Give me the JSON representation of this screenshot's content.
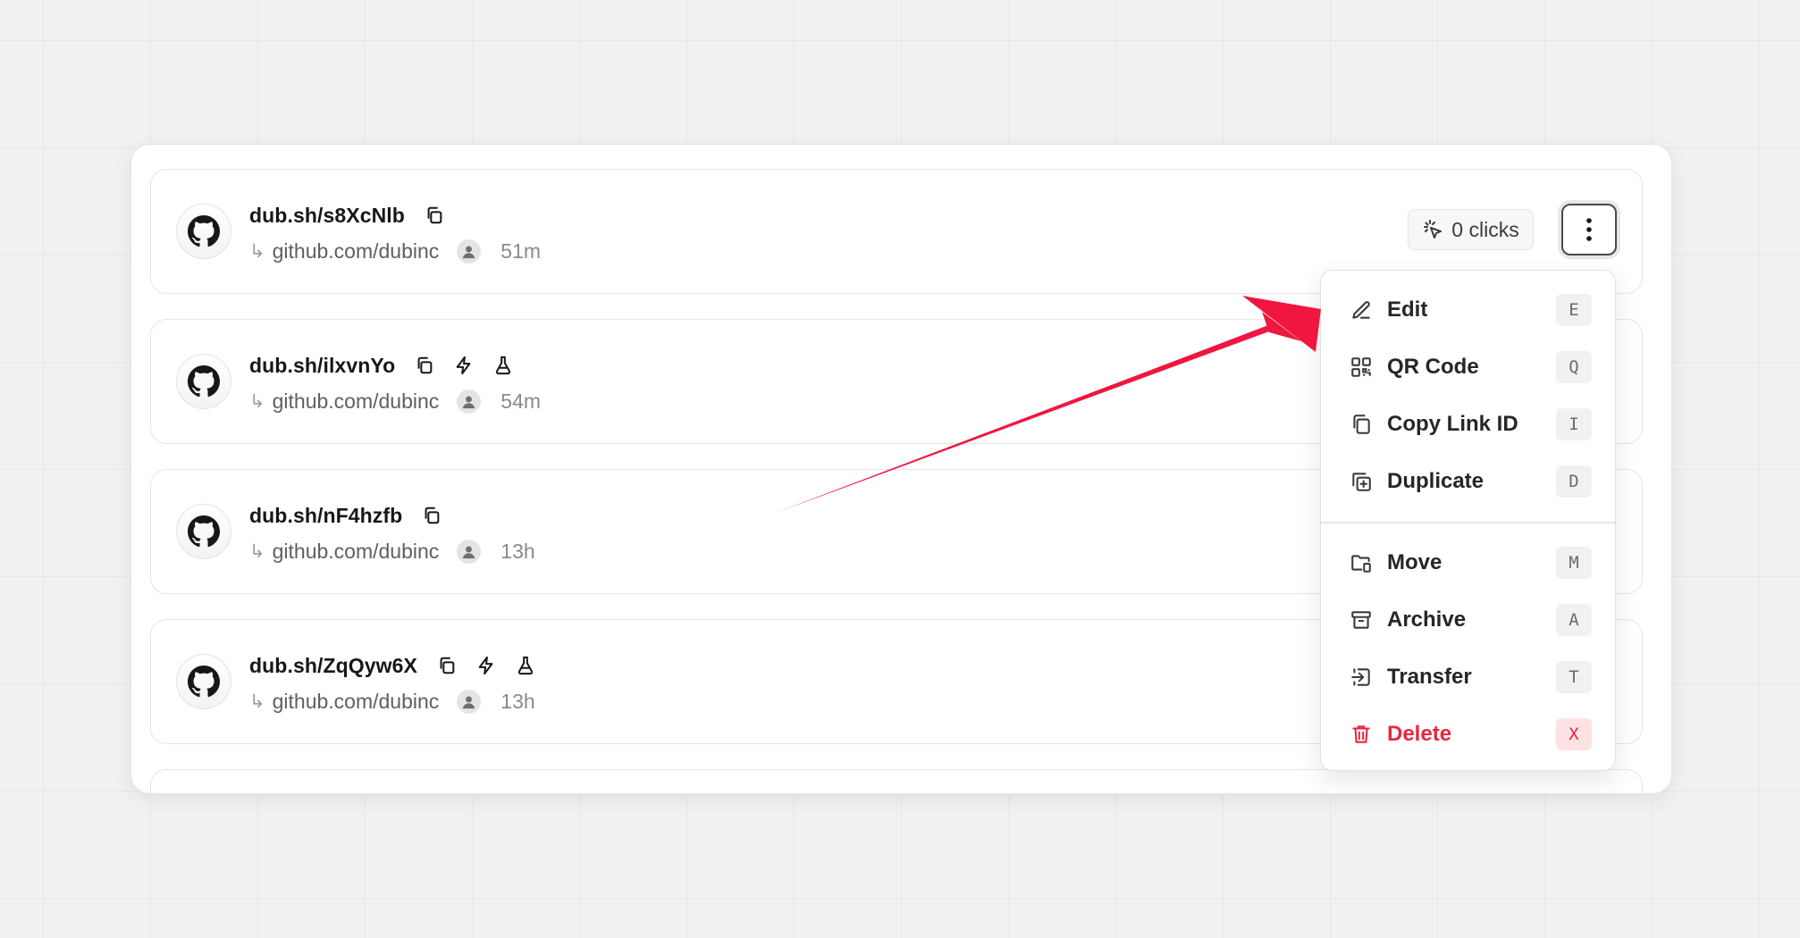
{
  "links": [
    {
      "short": "dub.sh/s8XcNlb",
      "dest": "github.com/dubinc",
      "age": "51m",
      "badges": []
    },
    {
      "short": "dub.sh/ilxvnYo",
      "dest": "github.com/dubinc",
      "age": "54m",
      "badges": [
        "bolt-icon",
        "flask-icon"
      ]
    },
    {
      "short": "dub.sh/nF4hzfb",
      "dest": "github.com/dubinc",
      "age": "13h",
      "badges": []
    },
    {
      "short": "dub.sh/ZqQyw6X",
      "dest": "github.com/dubinc",
      "age": "13h",
      "badges": [
        "bolt-icon",
        "flask-icon"
      ]
    }
  ],
  "clicks_label": "0 clicks",
  "dest_arrow": "↳",
  "menu": {
    "items": [
      {
        "label": "Edit",
        "shortcut": "E",
        "icon": "pencil-icon"
      },
      {
        "label": "QR Code",
        "shortcut": "Q",
        "icon": "qr-code-icon"
      },
      {
        "label": "Copy Link ID",
        "shortcut": "I",
        "icon": "copy-icon"
      },
      {
        "label": "Duplicate",
        "shortcut": "D",
        "icon": "duplicate-icon"
      },
      {
        "label": "Move",
        "shortcut": "M",
        "icon": "folder-move-icon"
      },
      {
        "label": "Archive",
        "shortcut": "A",
        "icon": "archive-icon"
      },
      {
        "label": "Transfer",
        "shortcut": "T",
        "icon": "transfer-icon"
      },
      {
        "label": "Delete",
        "shortcut": "X",
        "icon": "trash-icon"
      }
    ]
  },
  "colors": {
    "accent_arrow": "#f0163f",
    "danger": "#e5283e"
  }
}
